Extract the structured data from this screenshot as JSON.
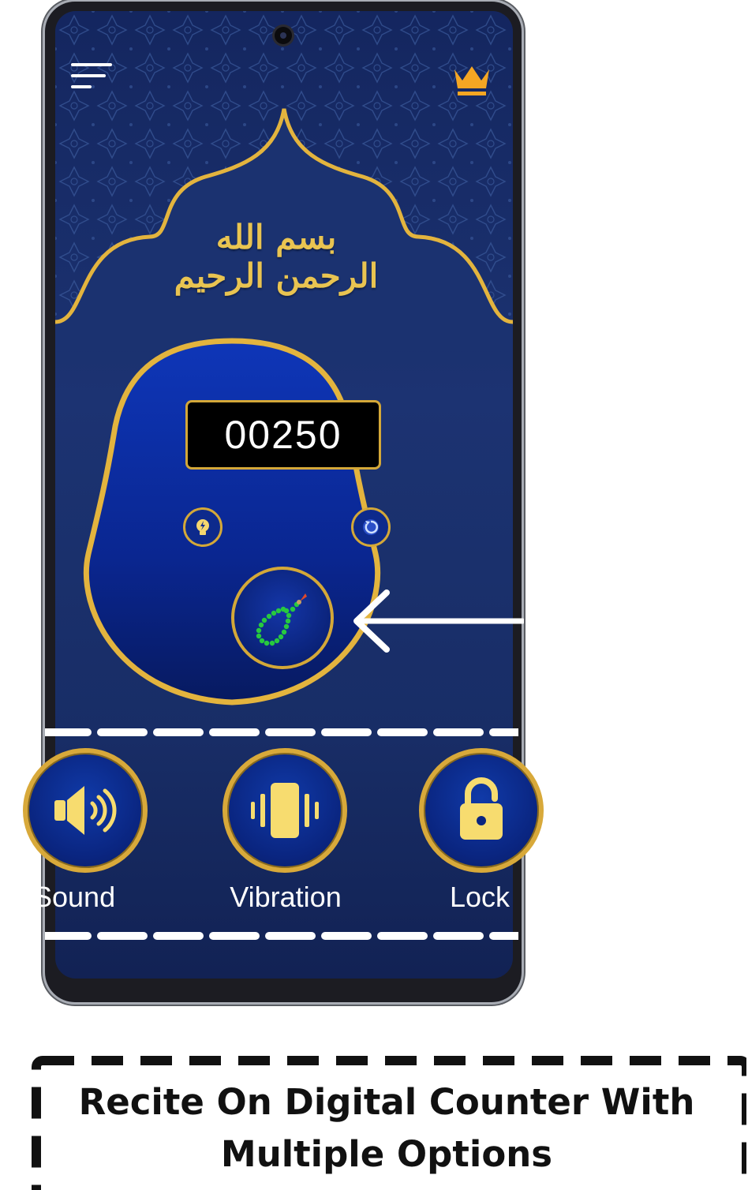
{
  "header": {
    "menu_icon": "hamburger-menu-icon",
    "premium_icon": "crown-icon"
  },
  "banner": {
    "calligraphy": "بسم الله الرحمن الرحيم"
  },
  "counter": {
    "value": "00250",
    "light_icon": "lightbulb-icon",
    "reset_icon": "reset-icon",
    "tap_icon": "prayer-beads-icon"
  },
  "options": [
    {
      "label": "Sound",
      "icon": "speaker-icon"
    },
    {
      "label": "Vibration",
      "icon": "vibration-icon"
    },
    {
      "label": "Lock",
      "icon": "lock-icon"
    }
  ],
  "caption": {
    "line1": "Recite On Digital Counter With",
    "line2": "Multiple Options"
  },
  "colors": {
    "gold": "#d4a838",
    "navy": "#14265f",
    "counter_blue": "#0d2a8c",
    "beads_green": "#27c93f",
    "crown_orange": "#f5a623"
  }
}
